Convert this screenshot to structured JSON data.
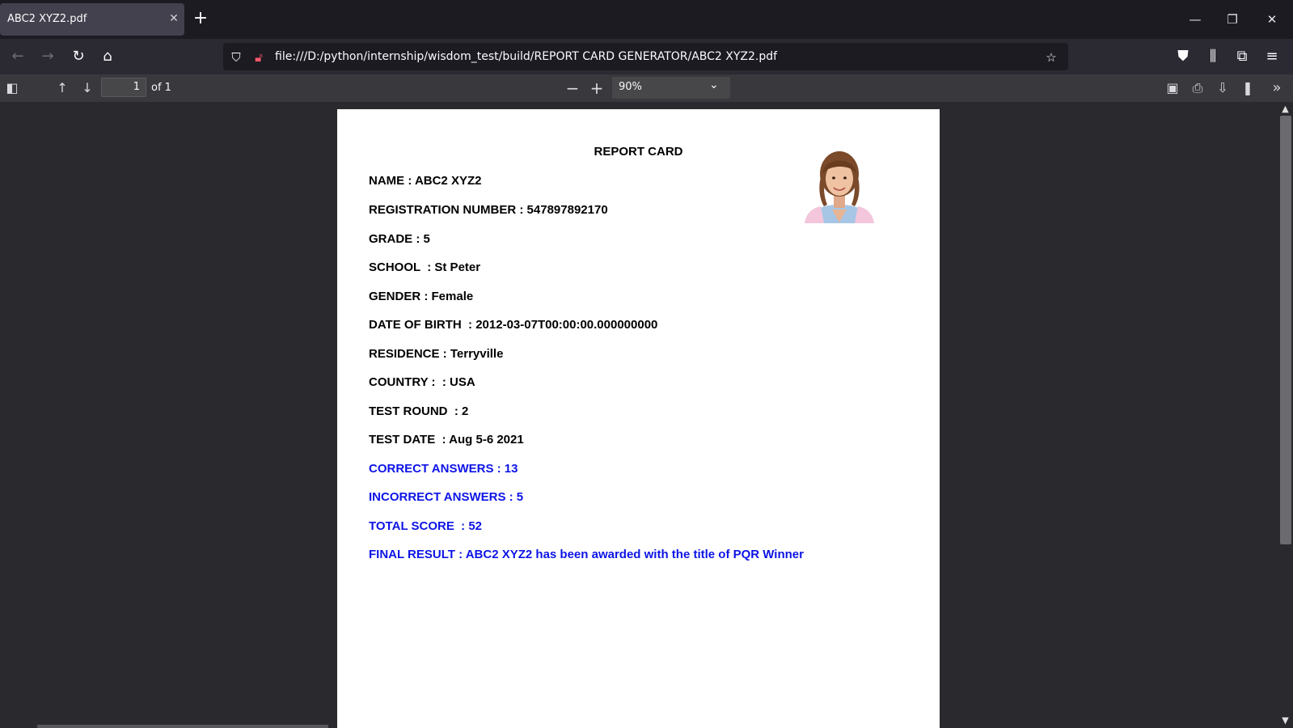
{
  "browser": {
    "tab_title": "ABC2 XYZ2.pdf",
    "url": "file:///D:/python/internship/wisdom_test/build/REPORT CARD GENERATOR/ABC2 XYZ2.pdf"
  },
  "pdf_toolbar": {
    "page_number": "1",
    "page_count": "of 1",
    "zoom": "90%"
  },
  "report": {
    "title": "REPORT CARD",
    "lines": [
      "NAME : ABC2 XYZ2",
      "REGISTRATION NUMBER : 547897892170",
      "GRADE : 5",
      "SCHOOL  : St Peter",
      "GENDER : Female",
      "DATE OF BIRTH  : 2012-03-07T00:00:00.000000000",
      "RESIDENCE : Terryville",
      "COUNTRY :  : USA",
      "TEST ROUND  : 2",
      "TEST DATE  : Aug 5-6 2021"
    ],
    "result_lines": [
      "CORRECT ANSWERS : 13",
      "INCORRECT ANSWERS : 5",
      "TOTAL SCORE  : 52",
      "FINAL RESULT : ABC2 XYZ2 has been awarded with the title of PQR Winner"
    ]
  },
  "colors": {
    "result_text": "#0d14e6",
    "tabbar_bg": "#1c1b22",
    "toolbar_bg": "#2b2a33"
  },
  "icons": [
    "back-icon",
    "forward-icon",
    "reload-icon",
    "home-icon",
    "shield-icon",
    "insecure-lock-icon",
    "star-icon",
    "pocket-icon",
    "library-icon",
    "extensions-icon",
    "menu-icon",
    "sidebar-toggle-icon",
    "arrow-up-icon",
    "arrow-down-icon",
    "zoom-out-icon",
    "zoom-in-icon",
    "presentation-icon",
    "print-icon",
    "save-icon",
    "bookmark-icon",
    "tools-icon"
  ]
}
